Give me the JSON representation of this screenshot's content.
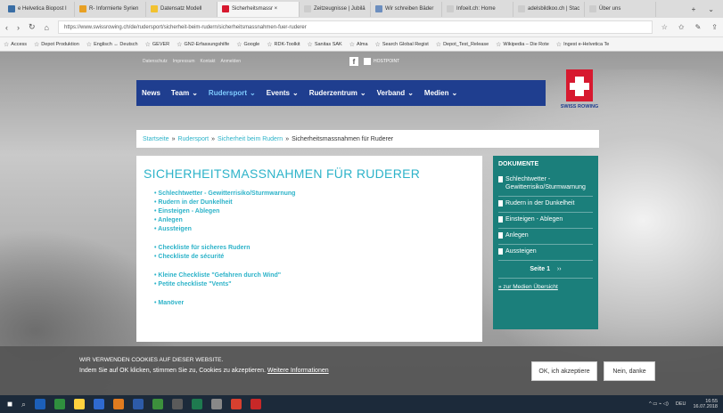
{
  "browser": {
    "tabs": [
      {
        "label": "e Helvetica Biopost I",
        "color": "#3a6ea5"
      },
      {
        "label": "R- Informierte Syrien",
        "color": "#e8a023"
      },
      {
        "label": "Datensatz Modell",
        "color": "#f2c230"
      },
      {
        "label": "Sicherheitsmassr ×",
        "color": "#d7192f",
        "active": true
      },
      {
        "label": "Zeitzeugnisse | Jubilä",
        "color": "#cccccc"
      },
      {
        "label": "Wir schreiben Bäder",
        "color": "#6c8ebf"
      },
      {
        "label": "Infoeit.ch: Home",
        "color": "#cccccc"
      },
      {
        "label": "adelsbildkoo.ch | Stac",
        "color": "#cccccc"
      },
      {
        "label": "Über uns",
        "color": "#cccccc"
      }
    ],
    "url": "https://www.swissrowing.ch/de/rudersport/sicherheit-beim-rudern/sicherheitsmassnahmen-fuer-ruderer",
    "bookmarks": [
      "Access",
      "Depot Produktion",
      "Englisch ↔ Deutsch",
      "GEVER",
      "GN2-Erfassungshilfe",
      "Google",
      "RDK-Toolkit",
      "Sanitas SAK",
      "Alma",
      "Search Global Regist",
      "Depot_Test_Release",
      "Wikipedia – Die Rote",
      "Ingest e-Helvetica Te"
    ]
  },
  "site": {
    "top_links": [
      "Datenschutz",
      "Impressum",
      "Kontakt",
      "Anmelden"
    ],
    "hostpoint": "HOSTPOINT",
    "nav": [
      {
        "label": "News",
        "active": false,
        "chevron": false
      },
      {
        "label": "Team",
        "active": false,
        "chevron": true
      },
      {
        "label": "Rudersport",
        "active": true,
        "chevron": true
      },
      {
        "label": "Events",
        "active": false,
        "chevron": true
      },
      {
        "label": "Ruderzentrum",
        "active": false,
        "chevron": true
      },
      {
        "label": "Verband",
        "active": false,
        "chevron": true
      },
      {
        "label": "Medien",
        "active": false,
        "chevron": true
      }
    ],
    "logo_text": "SWISS ROWING",
    "breadcrumb": {
      "items": [
        "Startseite",
        "Rudersport",
        "Sicherheit beim Rudern"
      ],
      "current": "Sicherheitsmassnahmen für Ruderer",
      "sep": "»"
    },
    "heading": "SICHERHEITSMASSNAHMEN FÜR RUDERER",
    "list_group1": [
      "Schlechtwetter - Gewitterrisiko/Sturmwarnung",
      "Rudern in der Dunkelheit",
      "Einsteigen - Ablegen",
      "Anlegen",
      "Aussteigen"
    ],
    "list_group2": [
      "Checkliste für sicheres Rudern",
      "Checkliste de sécurité"
    ],
    "list_group3": [
      "Kleine Checkliste \"Gefahren durch Wind\"",
      "Petite checkliste \"Vents\""
    ],
    "list_group4": [
      "Manöver"
    ],
    "sidebar": {
      "title": "DOKUMENTE",
      "items": [
        "Schlechtwetter - Gewitterrisiko/Sturmwarnung",
        "Rudern in der Dunkelheit",
        "Einsteigen - Ablegen",
        "Anlegen",
        "Aussteigen"
      ],
      "pager": "Seite 1",
      "pager_next": "››",
      "media_link": "» zur Medien Übersicht"
    }
  },
  "cookie": {
    "title": "WIR VERWENDEN COOKIES AUF DIESER WEBSITE.",
    "text": "Indem Sie auf OK klicken, stimmen Sie zu, Cookies zu akzeptieren.",
    "link": "Weitere Informationen",
    "accept": "OK, ich akzeptiere",
    "decline": "Nein, danke"
  },
  "taskbar": {
    "icons": [
      "#1c5fb8",
      "#2f8f3e",
      "#ffd23f",
      "#2f6ad0",
      "#e07b1f",
      "#2d5ba8",
      "#3c8f3c",
      "#5a5a5a",
      "#1e7a4f",
      "#888888",
      "#d8402f",
      "#c82828"
    ],
    "time": "16:55",
    "date": "16.07.2018",
    "lang": "DEU"
  }
}
